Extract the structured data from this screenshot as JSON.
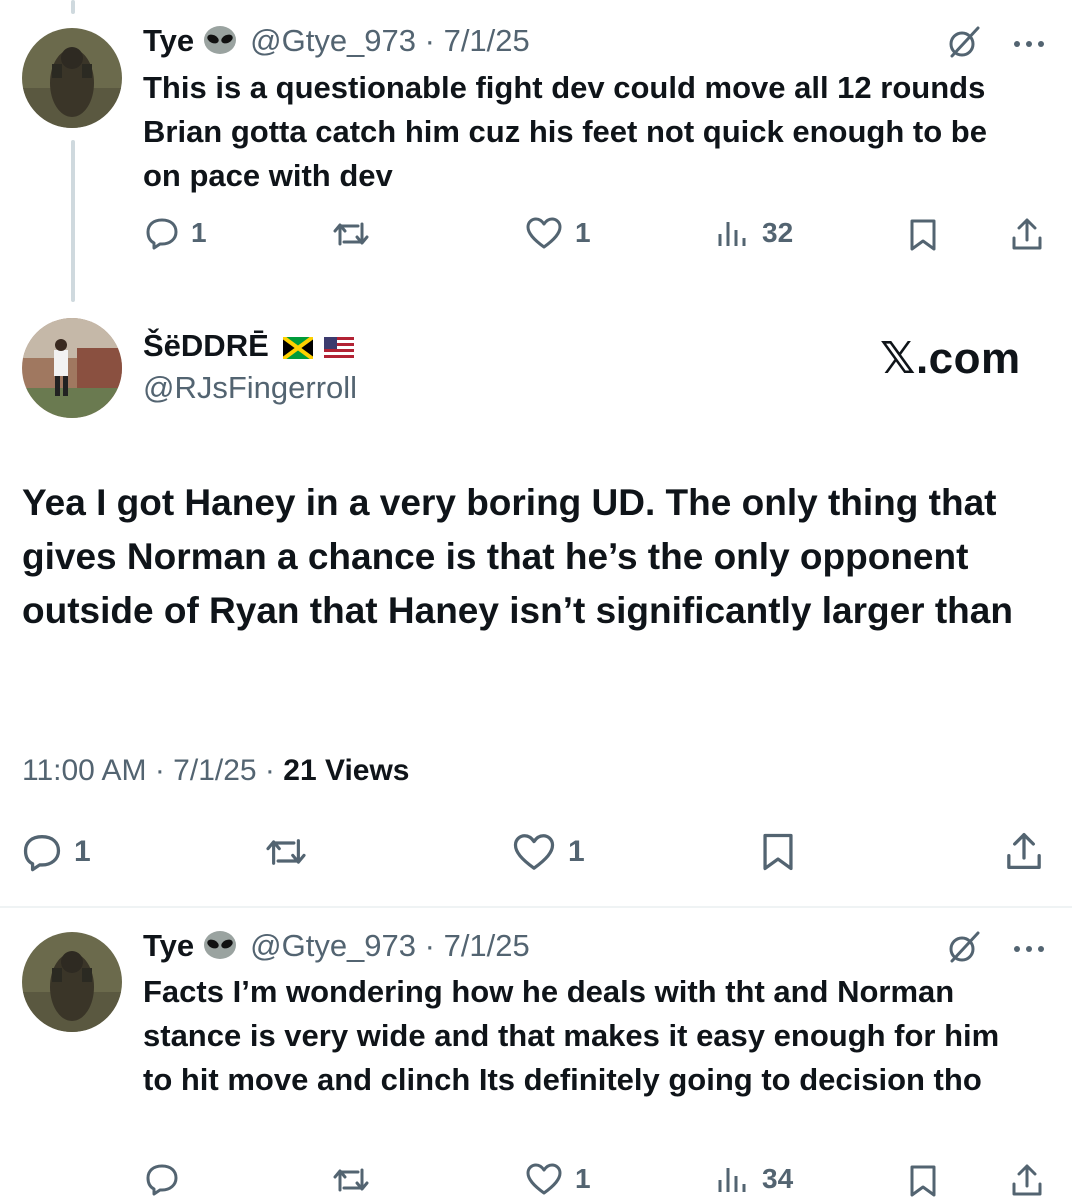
{
  "reply1": {
    "name": "Tye",
    "meta": "@Gtye_973 · 7/1/25",
    "text": "This is a questionable fight dev could move all 12 rounds Brian gotta catch him cuz his feet not quick enough to be on pace with dev",
    "replies": "1",
    "reposts": "",
    "likes": "1",
    "views": "32"
  },
  "main_tweet": {
    "name": "ŠëDDRĒ",
    "handle": "@RJsFingerroll",
    "watermark": "𝕏.com",
    "text": "Yea I got Haney in a very boring UD. The only thing that gives Norman a chance is that he’s the only opponent outside of Ryan that Haney isn’t significantly larger than",
    "timestamp": "11:00 AM · 7/1/25 · ",
    "views_label": "21 Views",
    "replies": "1",
    "reposts": "",
    "likes": "1"
  },
  "reply2": {
    "name": "Tye",
    "meta": "@Gtye_973 · 7/1/25",
    "text": "Facts I’m wondering how he deals with tht and Norman stance is very wide and that makes it easy enough for him to hit move and clinch Its definitely going to decision tho",
    "replies": "",
    "reposts": "",
    "likes": "1",
    "views": "34"
  },
  "colors": {
    "text": "#0f1419",
    "secondary": "#536471",
    "line": "#cfd9de"
  },
  "icons": [
    "alien-emoji-icon",
    "grok-icon",
    "more-icon",
    "reply-icon",
    "repost-icon",
    "like-icon",
    "views-icon",
    "bookmark-icon",
    "share-icon",
    "jamaica-flag-icon",
    "us-flag-icon"
  ]
}
